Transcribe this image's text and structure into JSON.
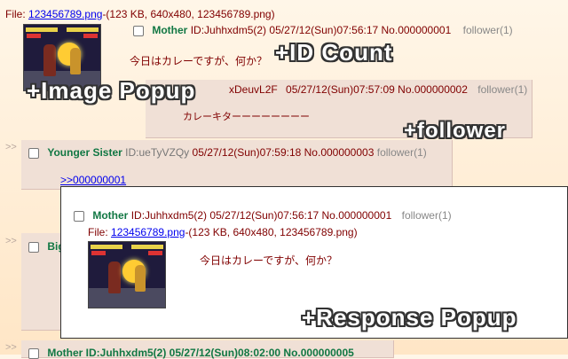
{
  "file_line": {
    "label": "File:",
    "filename": "123456789.png",
    "info": "-(123 KB, 640x480, 123456789.png)"
  },
  "post1": {
    "name": "Mother",
    "id": "ID:Juhhxdm5(2)",
    "date": "05/27/12(Sun)07:56:17",
    "no": "No.000000001",
    "follower": "follower(1)",
    "message": "今日はカレーですが、何か？"
  },
  "post2": {
    "arrow": ">>",
    "id": "xDeuvL2F",
    "date": "05/27/12(Sun)07:57:09",
    "no": "No.000000002",
    "follower": "follower(1)",
    "message": "カレーキターーーーーーーー"
  },
  "post3": {
    "arrow": ">>",
    "name": "Younger Sister",
    "id": "ID:ueTyVZQy",
    "date": "05/27/12(Sun)07:59:18",
    "no": "No.000000003",
    "follower": "follower(1)",
    "quote": ">>000000001"
  },
  "post4": {
    "arrow": ">>",
    "name_partial": "Big"
  },
  "post5": {
    "arrow": ">>",
    "text_partial": "Mother ID:Juhhxdm5(2) 05/27/12(Sun)08:02:00 No.000000005"
  },
  "popup": {
    "name": "Mother",
    "id": "ID:Juhhxdm5(2)",
    "date": "05/27/12(Sun)07:56:17",
    "no": "No.000000001",
    "follower": "follower(1)",
    "file_label": "File:",
    "filename": "123456789.png",
    "file_info": "-(123 KB, 640x480, 123456789.png)",
    "message": "今日はカレーですが、何か？"
  },
  "overlays": {
    "id_count": "+ID Count",
    "image_popup": "+Image Popup",
    "follower": "+follower",
    "response_popup": "+Response Popup"
  }
}
